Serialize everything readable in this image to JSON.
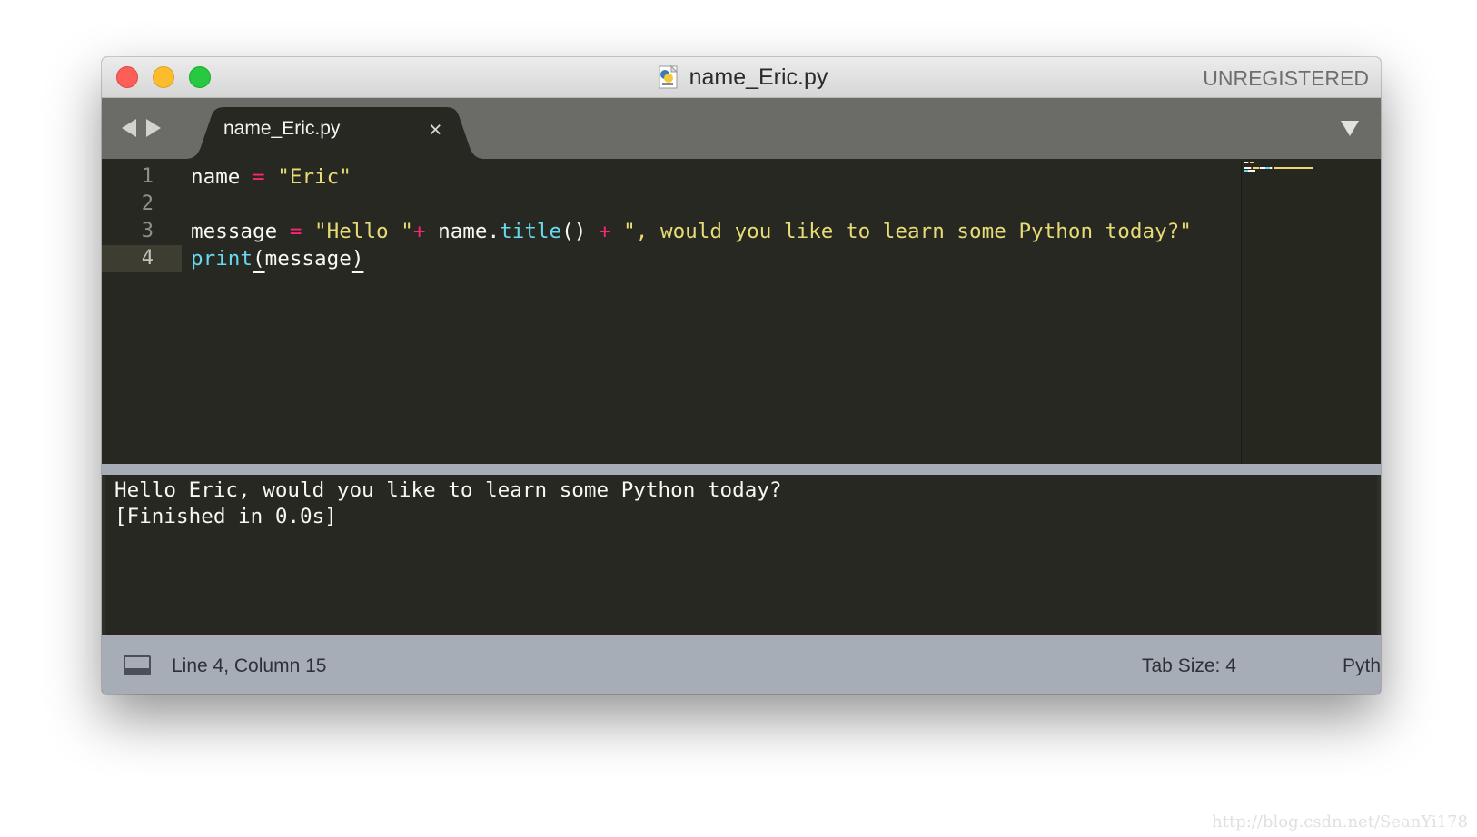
{
  "window": {
    "title": "name_Eric.py",
    "registration_status": "UNREGISTERED",
    "traffic_lights": [
      "close",
      "minimize",
      "zoom"
    ],
    "file_icon": "python-file-icon"
  },
  "tabs": {
    "nav_back_icon": "triangle-left-icon",
    "nav_forward_icon": "triangle-right-icon",
    "active": {
      "label": "name_Eric.py",
      "close_glyph": "×"
    },
    "dropdown_icon": "triangle-down-icon"
  },
  "editor": {
    "theme": "Monokai",
    "colors": {
      "background": "#272822",
      "keyword_operator": "#f92672",
      "string": "#e6db74",
      "function": "#66d9ef",
      "text": "#f8f8f2"
    },
    "line_numbers": [
      "1",
      "2",
      "3",
      "4"
    ],
    "active_line": "4",
    "lines": [
      [
        {
          "t": "name ",
          "c": "plain"
        },
        {
          "t": "=",
          "c": "op"
        },
        {
          "t": " ",
          "c": "plain"
        },
        {
          "t": "\"Eric\"",
          "c": "str"
        }
      ],
      [],
      [
        {
          "t": "message ",
          "c": "plain"
        },
        {
          "t": "=",
          "c": "op"
        },
        {
          "t": " ",
          "c": "plain"
        },
        {
          "t": "\"Hello \"",
          "c": "str"
        },
        {
          "t": "+",
          "c": "op"
        },
        {
          "t": " name.",
          "c": "plain"
        },
        {
          "t": "title",
          "c": "fn"
        },
        {
          "t": "() ",
          "c": "plain"
        },
        {
          "t": "+",
          "c": "op"
        },
        {
          "t": " ",
          "c": "plain"
        },
        {
          "t": "\", would you like to learn some Python today?\"",
          "c": "str"
        }
      ],
      [
        {
          "t": "print",
          "c": "fn"
        },
        {
          "t": "(",
          "c": "bracket"
        },
        {
          "t": "message",
          "c": "plain"
        },
        {
          "t": ")",
          "c": "bracket"
        }
      ]
    ]
  },
  "output": {
    "lines": [
      "Hello Eric, would you like to learn some Python today?",
      "[Finished in 0.0s]"
    ]
  },
  "statusbar": {
    "panel_icon": "panel-toggle-icon",
    "position": "Line 4, Column 15",
    "tab_size": "Tab Size: 4",
    "syntax": "Python"
  },
  "watermark": "http://blog.csdn.net/SeanYi178"
}
